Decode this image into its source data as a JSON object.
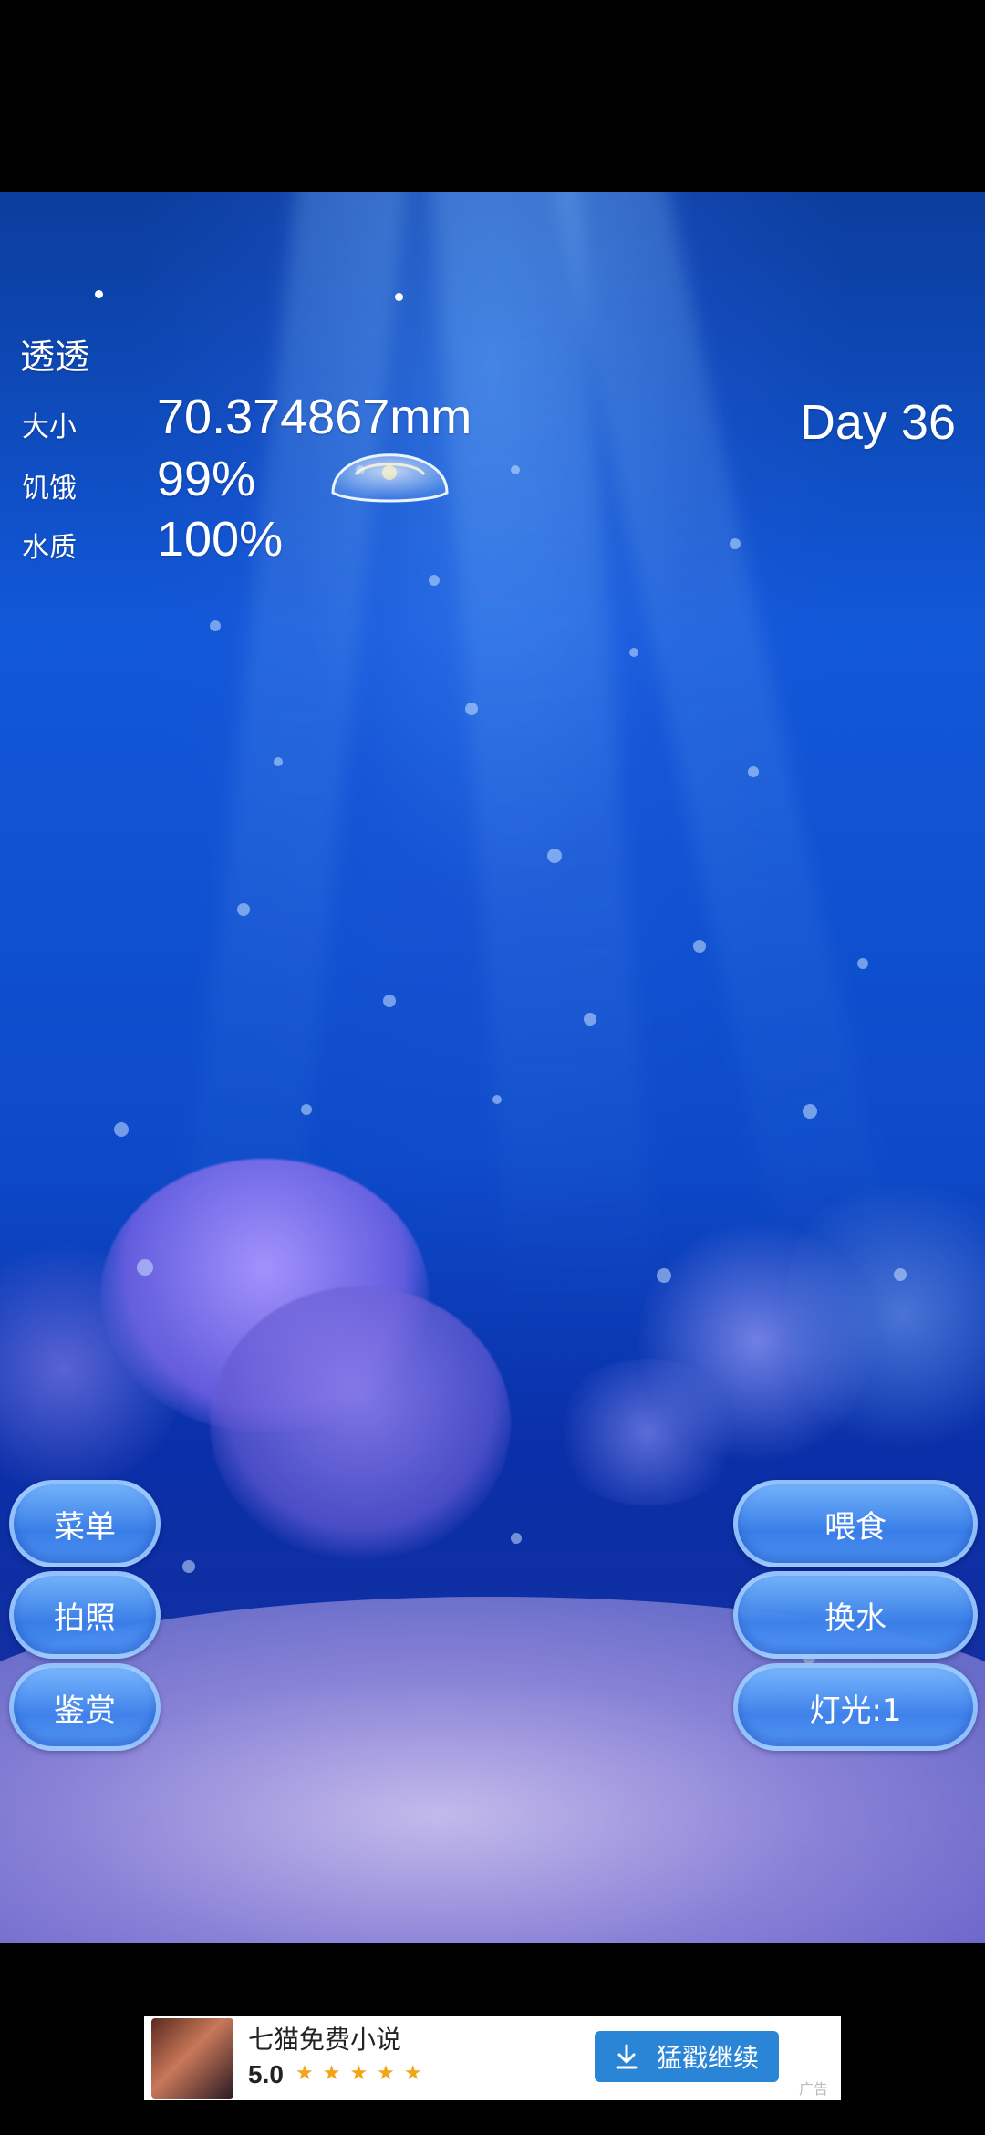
{
  "hud": {
    "pet_name": "透透",
    "stats": [
      {
        "label": "大小",
        "value": "70.374867mm"
      },
      {
        "label": "饥饿",
        "value": "99%"
      },
      {
        "label": "水质",
        "value": "100%"
      }
    ],
    "day": "Day 36"
  },
  "buttons": {
    "menu": "菜单",
    "photo": "拍照",
    "appreciate": "鉴赏",
    "feed": "喂食",
    "change_water": "换水",
    "light": "灯光:1"
  },
  "ad": {
    "title": "七猫免费小说",
    "rating": "5.0",
    "stars": "★★★★★",
    "cta_label": "猛戳继续",
    "tag": "广告"
  },
  "colors": {
    "ocean_top": "#0b3d9c",
    "ocean_mid": "#1158d9",
    "button_blue": "#4a9bf0",
    "ad_button": "#2a85d6",
    "star": "#f2a516"
  },
  "icons": {
    "jellyfish": "jellyfish-sprite",
    "download": "download-icon"
  }
}
